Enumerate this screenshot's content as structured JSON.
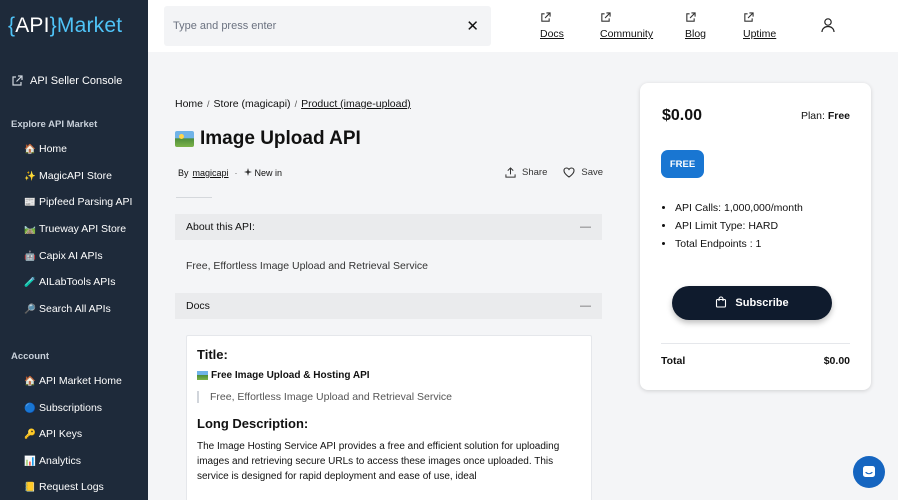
{
  "logo": {
    "open": "{",
    "api": "API",
    "close": "}",
    "market": "Market"
  },
  "sidebar": {
    "console_label": "API Seller Console",
    "explore_heading": "Explore API Market",
    "explore_items": [
      {
        "emoji": "🏠",
        "label": "Home"
      },
      {
        "emoji": "✨",
        "label": "MagicAPI Store"
      },
      {
        "emoji": "📰",
        "label": "Pipfeed Parsing API"
      },
      {
        "emoji": "🛤️",
        "label": "Trueway API Store"
      },
      {
        "emoji": "🤖",
        "label": "Capix AI APIs"
      },
      {
        "emoji": "🧪",
        "label": "AILabTools APIs"
      },
      {
        "emoji": "🔎",
        "label": "Search All APIs"
      }
    ],
    "account_heading": "Account",
    "account_items": [
      {
        "emoji": "🏠",
        "label": "API Market Home"
      },
      {
        "emoji": "🔵",
        "label": "Subscriptions"
      },
      {
        "emoji": "🔑",
        "label": "API Keys"
      },
      {
        "emoji": "📊",
        "label": "Analytics"
      },
      {
        "emoji": "📒",
        "label": "Request Logs"
      }
    ]
  },
  "topbar": {
    "search_placeholder": "Type and press enter",
    "clear_glyph": "✕",
    "links": [
      "Docs",
      "Community",
      "Blog",
      "Uptime"
    ]
  },
  "breadcrumb": {
    "home": "Home",
    "store": "Store (magicapi)",
    "current": "Product (image-upload)",
    "sep": "/"
  },
  "product": {
    "title": "Image Upload API",
    "by": "By",
    "author": "magicapi",
    "dot": "·",
    "new_label": "New in",
    "share": "Share",
    "save": "Save"
  },
  "about": {
    "heading": "About this API:",
    "toggle": "—",
    "text": "Free, Effortless Image Upload and Retrieval Service"
  },
  "docs": {
    "heading": "Docs",
    "toggle": "—",
    "title_heading": "Title:",
    "subtitle": "Free Image Upload & Hosting API",
    "quote": "Free, Effortless Image Upload and Retrieval Service",
    "long_heading": "Long Description:",
    "long_text": "The Image Hosting Service API provides a free and efficient solution for uploading images and retrieving secure URLs to access these images once uploaded. This service is designed for rapid deployment and ease of use, ideal"
  },
  "pricing": {
    "price": "$0.00",
    "plan_label": "Plan:",
    "plan_value": "Free",
    "badge": "FREE",
    "features": [
      "API Calls: 1,000,000/month",
      "API Limit Type: HARD",
      "Total Endpoints : 1"
    ],
    "subscribe": "Subscribe",
    "total_label": "Total",
    "total_value": "$0.00"
  },
  "colors": {
    "sidebar_bg": "#1e2a3a",
    "accent": "#4fc3f7",
    "badge": "#1976d2",
    "button": "#0f1b2d",
    "chat": "#1565c0"
  }
}
